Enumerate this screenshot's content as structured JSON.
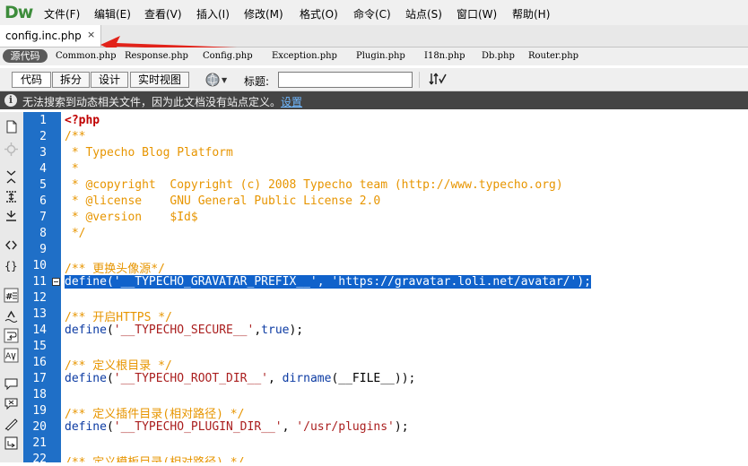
{
  "app": {
    "logo": "Dw",
    "menu": [
      "文件(F)",
      "编辑(E)",
      "查看(V)",
      "插入(I)",
      "修改(M)",
      "格式(O)",
      "命令(C)",
      "站点(S)",
      "窗口(W)",
      "帮助(H)"
    ]
  },
  "document_tab": {
    "label": "config.inc.php",
    "close": "×"
  },
  "related_files": {
    "source_label": "源代码",
    "files": [
      "Common.php",
      "Response.php",
      "Config.php",
      "Exception.php",
      "Plugin.php",
      "I18n.php",
      "Db.php",
      "Router.php"
    ]
  },
  "toolbar": {
    "views": [
      "代码",
      "拆分",
      "设计",
      "实时视图"
    ],
    "title_label": "标题:",
    "title_value": ""
  },
  "infobar": {
    "message": "无法搜索到动态相关文件，因为此文档没有站点定义。",
    "link": "设置"
  },
  "colors": {
    "gutter": "#1f6fc7",
    "selection": "#1062cb",
    "comment": "#e79500",
    "string": "#aa1e1e",
    "keyword": "#0c3ba3",
    "tag": "#c00000"
  },
  "left_toolbar_icons": [
    "open-documents-icon",
    "show-code-navigator-icon",
    "collapse-full-tag-icon",
    "collapse-selection-icon",
    "expand-all-icon",
    "select-parent-tag-icon",
    "balance-braces-icon",
    "line-numbers-icon",
    "highlight-invalid-code-icon",
    "word-wrap-icon",
    "syntax-coloring-icon",
    "apply-comment-icon",
    "remove-comment-icon",
    "wrap-tag-icon",
    "recent-snippets-icon"
  ],
  "editor": {
    "line_numbers": [
      "1",
      "2",
      "3",
      "4",
      "5",
      "6",
      "7",
      "8",
      "9",
      "10",
      "11",
      "12",
      "13",
      "14",
      "15",
      "16",
      "17",
      "18",
      "19",
      "20",
      "21",
      "22"
    ],
    "lines": [
      {
        "tokens": [
          {
            "t": "tag",
            "v": "<?php"
          }
        ]
      },
      {
        "tokens": [
          {
            "t": "comment",
            "v": "/**"
          }
        ]
      },
      {
        "tokens": [
          {
            "t": "comment",
            "v": " * Typecho Blog Platform"
          }
        ]
      },
      {
        "tokens": [
          {
            "t": "comment",
            "v": " *"
          }
        ]
      },
      {
        "tokens": [
          {
            "t": "comment",
            "v": " * @copyright  Copyright (c) 2008 Typecho team (http://www.typecho.org)"
          }
        ]
      },
      {
        "tokens": [
          {
            "t": "comment",
            "v": " * @license    GNU General Public License 2.0"
          }
        ]
      },
      {
        "tokens": [
          {
            "t": "comment",
            "v": " * @version    $Id$"
          }
        ]
      },
      {
        "tokens": [
          {
            "t": "comment",
            "v": " */"
          }
        ]
      },
      {
        "tokens": []
      },
      {
        "tokens": [
          {
            "t": "comment",
            "v": "/** 更换头像源*/"
          }
        ]
      },
      {
        "selected": true,
        "tokens": [
          {
            "t": "plain",
            "v": "define('__TYPECHO_GRAVATAR_PREFIX__', 'https://gravatar.loli.net/avatar/');"
          }
        ]
      },
      {
        "tokens": []
      },
      {
        "tokens": [
          {
            "t": "comment",
            "v": "/** 开启HTTPS */"
          }
        ]
      },
      {
        "tokens": [
          {
            "t": "fn",
            "v": "define"
          },
          {
            "t": "plain",
            "v": "("
          },
          {
            "t": "str",
            "v": "'__TYPECHO_SECURE__'"
          },
          {
            "t": "plain",
            "v": ","
          },
          {
            "t": "kw",
            "v": "true"
          },
          {
            "t": "plain",
            "v": ");"
          }
        ]
      },
      {
        "tokens": []
      },
      {
        "tokens": [
          {
            "t": "comment",
            "v": "/** 定义根目录 */"
          }
        ]
      },
      {
        "tokens": [
          {
            "t": "fn",
            "v": "define"
          },
          {
            "t": "plain",
            "v": "("
          },
          {
            "t": "str",
            "v": "'__TYPECHO_ROOT_DIR__'"
          },
          {
            "t": "plain",
            "v": ", "
          },
          {
            "t": "fn",
            "v": "dirname"
          },
          {
            "t": "plain",
            "v": "(__FILE__));"
          }
        ]
      },
      {
        "tokens": []
      },
      {
        "tokens": [
          {
            "t": "comment",
            "v": "/** 定义插件目录(相对路径) */"
          }
        ]
      },
      {
        "tokens": [
          {
            "t": "fn",
            "v": "define"
          },
          {
            "t": "plain",
            "v": "("
          },
          {
            "t": "str",
            "v": "'__TYPECHO_PLUGIN_DIR__'"
          },
          {
            "t": "plain",
            "v": ", "
          },
          {
            "t": "str",
            "v": "'/usr/plugins'"
          },
          {
            "t": "plain",
            "v": ");"
          }
        ]
      },
      {
        "tokens": []
      },
      {
        "tokens": [
          {
            "t": "comment",
            "v": "/** 定义模板目录(相对路径) */"
          }
        ]
      }
    ]
  }
}
